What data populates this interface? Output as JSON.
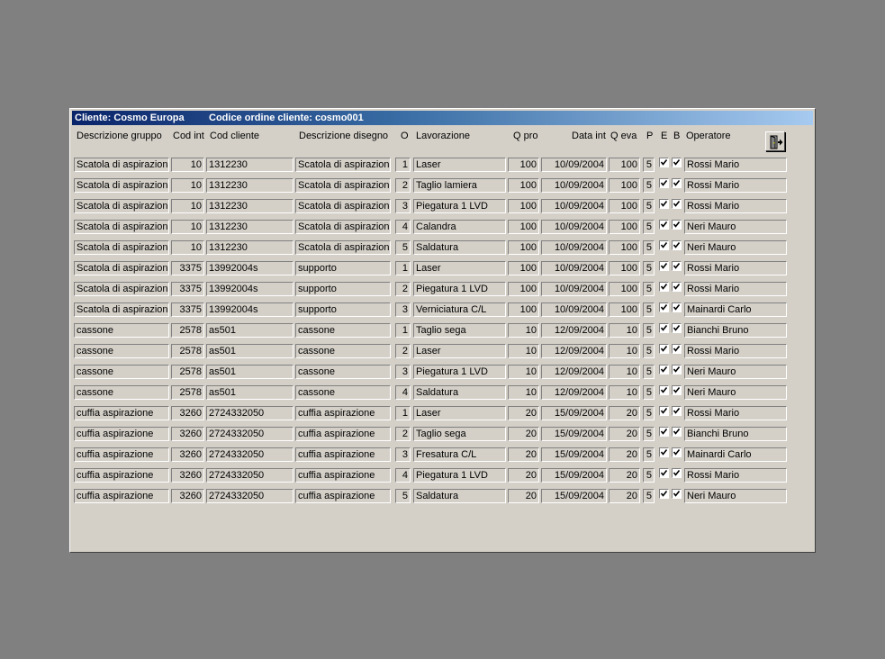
{
  "window": {
    "title_cliente": "Cliente: Cosmo Europa",
    "title_codice": "Codice ordine cliente: cosmo001"
  },
  "headers": {
    "descrizione_gruppo": "Descrizione gruppo",
    "cod_int": "Cod int",
    "cod_cliente": "Cod cliente",
    "descrizione_disegno": "Descrizione disegno",
    "o": "O",
    "lavorazione": "Lavorazione",
    "q_pro": "Q pro",
    "data_int": "Data int",
    "q_eva": "Q eva",
    "p": "P",
    "e": "E",
    "b": "B",
    "operatore": "Operatore"
  },
  "exit_button": {
    "icon": "exit-door-icon"
  },
  "rows": [
    {
      "gruppo": "Scatola di aspirazione",
      "cod_int": "10",
      "cod_cliente": "1312230",
      "disegno": "Scatola di aspirazione",
      "o": "1",
      "lavorazione": "Laser",
      "q_pro": "100",
      "data_int": "10/09/2004",
      "q_eva": "100",
      "p": "5",
      "e": true,
      "b": true,
      "operatore": "Rossi Mario"
    },
    {
      "gruppo": "Scatola di aspirazione",
      "cod_int": "10",
      "cod_cliente": "1312230",
      "disegno": "Scatola di aspirazione",
      "o": "2",
      "lavorazione": "Taglio lamiera",
      "q_pro": "100",
      "data_int": "10/09/2004",
      "q_eva": "100",
      "p": "5",
      "e": true,
      "b": true,
      "operatore": "Rossi Mario"
    },
    {
      "gruppo": "Scatola di aspirazione",
      "cod_int": "10",
      "cod_cliente": "1312230",
      "disegno": "Scatola di aspirazione",
      "o": "3",
      "lavorazione": "Piegatura 1 LVD",
      "q_pro": "100",
      "data_int": "10/09/2004",
      "q_eva": "100",
      "p": "5",
      "e": true,
      "b": true,
      "operatore": "Rossi Mario"
    },
    {
      "gruppo": "Scatola di aspirazione",
      "cod_int": "10",
      "cod_cliente": "1312230",
      "disegno": "Scatola di aspirazione",
      "o": "4",
      "lavorazione": "Calandra",
      "q_pro": "100",
      "data_int": "10/09/2004",
      "q_eva": "100",
      "p": "5",
      "e": true,
      "b": true,
      "operatore": "Neri Mauro"
    },
    {
      "gruppo": "Scatola di aspirazione",
      "cod_int": "10",
      "cod_cliente": "1312230",
      "disegno": "Scatola di aspirazione",
      "o": "5",
      "lavorazione": "Saldatura",
      "q_pro": "100",
      "data_int": "10/09/2004",
      "q_eva": "100",
      "p": "5",
      "e": true,
      "b": true,
      "operatore": "Neri Mauro"
    },
    {
      "gruppo": "Scatola di aspirazione",
      "cod_int": "3375",
      "cod_cliente": "13992004s",
      "disegno": "supporto",
      "o": "1",
      "lavorazione": "Laser",
      "q_pro": "100",
      "data_int": "10/09/2004",
      "q_eva": "100",
      "p": "5",
      "e": true,
      "b": true,
      "operatore": "Rossi Mario"
    },
    {
      "gruppo": "Scatola di aspirazione",
      "cod_int": "3375",
      "cod_cliente": "13992004s",
      "disegno": "supporto",
      "o": "2",
      "lavorazione": "Piegatura 1 LVD",
      "q_pro": "100",
      "data_int": "10/09/2004",
      "q_eva": "100",
      "p": "5",
      "e": true,
      "b": true,
      "operatore": "Rossi Mario"
    },
    {
      "gruppo": "Scatola di aspirazione",
      "cod_int": "3375",
      "cod_cliente": "13992004s",
      "disegno": "supporto",
      "o": "3",
      "lavorazione": "Verniciatura C/L",
      "q_pro": "100",
      "data_int": "10/09/2004",
      "q_eva": "100",
      "p": "5",
      "e": true,
      "b": true,
      "operatore": "Mainardi Carlo"
    },
    {
      "gruppo": "cassone",
      "cod_int": "2578",
      "cod_cliente": "as501",
      "disegno": "cassone",
      "o": "1",
      "lavorazione": "Taglio sega",
      "q_pro": "10",
      "data_int": "12/09/2004",
      "q_eva": "10",
      "p": "5",
      "e": true,
      "b": true,
      "operatore": "Bianchi Bruno"
    },
    {
      "gruppo": "cassone",
      "cod_int": "2578",
      "cod_cliente": "as501",
      "disegno": "cassone",
      "o": "2",
      "lavorazione": "Laser",
      "q_pro": "10",
      "data_int": "12/09/2004",
      "q_eva": "10",
      "p": "5",
      "e": true,
      "b": true,
      "operatore": "Rossi Mario"
    },
    {
      "gruppo": "cassone",
      "cod_int": "2578",
      "cod_cliente": "as501",
      "disegno": "cassone",
      "o": "3",
      "lavorazione": "Piegatura 1 LVD",
      "q_pro": "10",
      "data_int": "12/09/2004",
      "q_eva": "10",
      "p": "5",
      "e": true,
      "b": true,
      "operatore": "Neri Mauro"
    },
    {
      "gruppo": "cassone",
      "cod_int": "2578",
      "cod_cliente": "as501",
      "disegno": "cassone",
      "o": "4",
      "lavorazione": "Saldatura",
      "q_pro": "10",
      "data_int": "12/09/2004",
      "q_eva": "10",
      "p": "5",
      "e": true,
      "b": true,
      "operatore": "Neri Mauro"
    },
    {
      "gruppo": "cuffia aspirazione",
      "cod_int": "3260",
      "cod_cliente": "2724332050",
      "disegno": "cuffia aspirazione",
      "o": "1",
      "lavorazione": "Laser",
      "q_pro": "20",
      "data_int": "15/09/2004",
      "q_eva": "20",
      "p": "5",
      "e": true,
      "b": true,
      "operatore": "Rossi Mario"
    },
    {
      "gruppo": "cuffia aspirazione",
      "cod_int": "3260",
      "cod_cliente": "2724332050",
      "disegno": "cuffia aspirazione",
      "o": "2",
      "lavorazione": "Taglio sega",
      "q_pro": "20",
      "data_int": "15/09/2004",
      "q_eva": "20",
      "p": "5",
      "e": true,
      "b": true,
      "operatore": "Bianchi Bruno"
    },
    {
      "gruppo": "cuffia aspirazione",
      "cod_int": "3260",
      "cod_cliente": "2724332050",
      "disegno": "cuffia aspirazione",
      "o": "3",
      "lavorazione": "Fresatura C/L",
      "q_pro": "20",
      "data_int": "15/09/2004",
      "q_eva": "20",
      "p": "5",
      "e": true,
      "b": true,
      "operatore": "Mainardi Carlo"
    },
    {
      "gruppo": "cuffia aspirazione",
      "cod_int": "3260",
      "cod_cliente": "2724332050",
      "disegno": "cuffia aspirazione",
      "o": "4",
      "lavorazione": "Piegatura 1 LVD",
      "q_pro": "20",
      "data_int": "15/09/2004",
      "q_eva": "20",
      "p": "5",
      "e": true,
      "b": true,
      "operatore": "Rossi Mario"
    },
    {
      "gruppo": "cuffia aspirazione",
      "cod_int": "3260",
      "cod_cliente": "2724332050",
      "disegno": "cuffia aspirazione",
      "o": "5",
      "lavorazione": "Saldatura",
      "q_pro": "20",
      "data_int": "15/09/2004",
      "q_eva": "20",
      "p": "5",
      "e": true,
      "b": true,
      "operatore": "Neri Mauro"
    }
  ]
}
